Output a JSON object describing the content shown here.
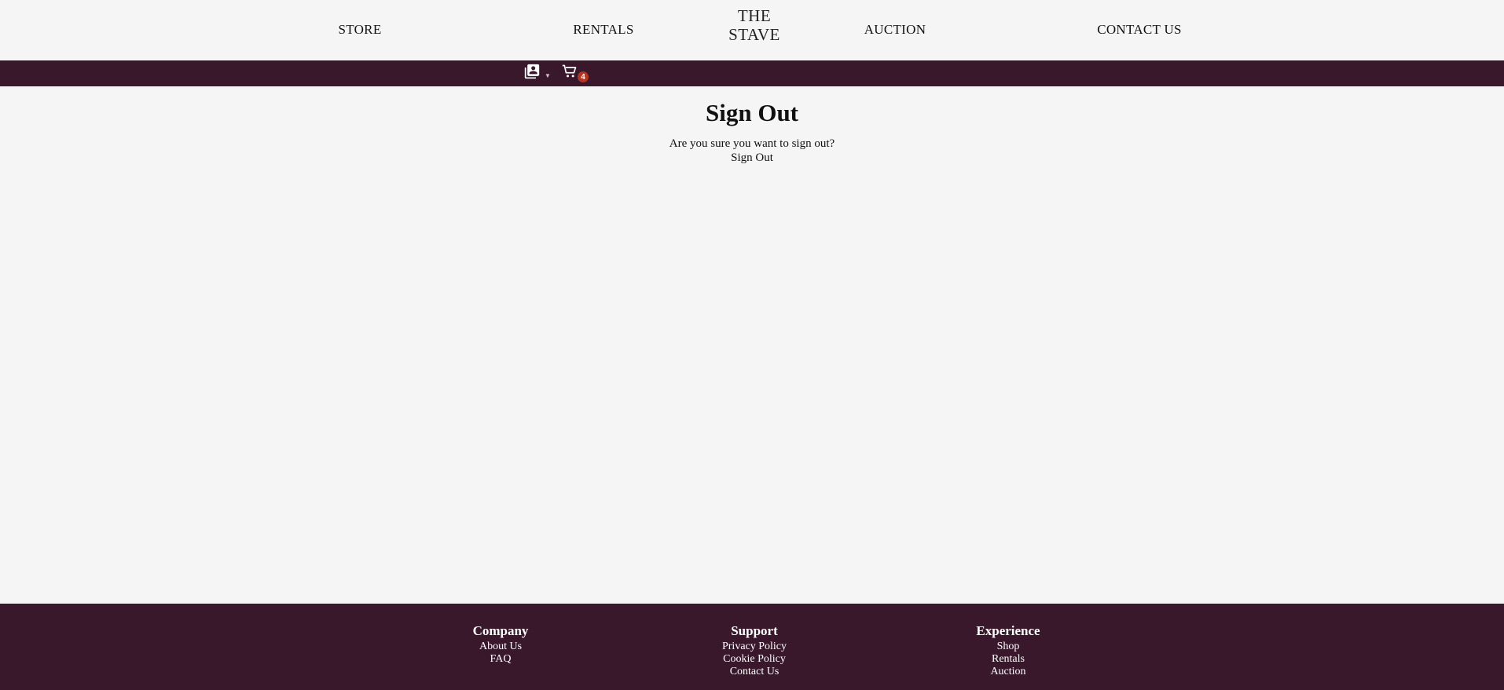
{
  "nav": {
    "store": "STORE",
    "rentals": "RENTALS",
    "logo_line1": "THE",
    "logo_line2": "STAVE",
    "auction": "AUCTION",
    "contact": "CONTACT US"
  },
  "account_bar": {
    "account_icon": "account-box-icon",
    "caret_icon": "caret-down-icon",
    "cart_icon": "shopping-cart-icon",
    "cart_count": "4",
    "bar_color": "#3a182c",
    "badge_color": "#b5341e"
  },
  "main": {
    "title": "Sign Out",
    "prompt": "Are you sure you want to sign out?",
    "signout_label": "Sign Out"
  },
  "footer": {
    "company": {
      "heading": "Company",
      "links": [
        "About Us",
        "FAQ"
      ]
    },
    "support": {
      "heading": "Support",
      "links": [
        "Privacy Policy",
        "Cookie Policy",
        "Contact Us"
      ]
    },
    "experience": {
      "heading": "Experience",
      "links": [
        "Shop",
        "Rentals",
        "Auction"
      ]
    }
  }
}
